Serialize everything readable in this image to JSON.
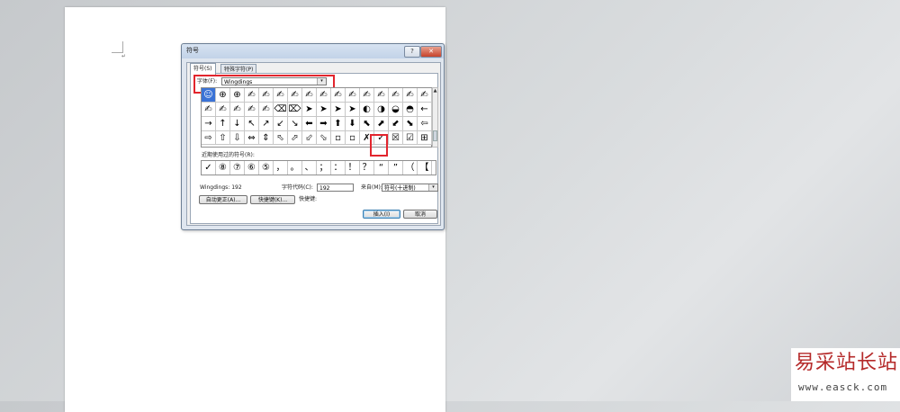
{
  "document": {
    "paragraph_mark": "↵"
  },
  "dialog": {
    "title": "符号",
    "help_label": "?",
    "close_label": "✕",
    "tabs": [
      {
        "label": "符号(S)"
      },
      {
        "label": "特殊字符(P)"
      }
    ],
    "font_label": "字体(F):",
    "font_value": "Wingdings",
    "dropdown_arrow": "▾",
    "scroll_up": "▲",
    "symbols": [
      [
        "☺",
        "⊕",
        "⊕",
        "✍",
        "✍",
        "✍",
        "✍",
        "✍",
        "✍",
        "✍",
        "✍",
        "✍",
        "✍",
        "✍",
        "✍",
        "✍",
        "✍",
        "✍",
        "✍",
        "✍",
        "✍",
        "✍",
        "✍",
        "✍",
        "✍",
        "✍",
        "✍",
        "✍"
      ],
      [
        "✍",
        "✍",
        "✍",
        "✍",
        "✍",
        "⌫",
        "⌦",
        "➤",
        "➤",
        "➤",
        "➤",
        "◐",
        "◑",
        "◒",
        "◓",
        "←",
        "",
        "",
        "",
        "",
        "",
        "",
        "",
        "",
        "",
        "",
        "",
        ""
      ],
      [
        "→",
        "↑",
        "↓",
        "↖",
        "↗",
        "↙",
        "↘",
        "⬅",
        "➡",
        "⬆",
        "⬇",
        "⬉",
        "⬈",
        "⬋",
        "⬊",
        "⇦",
        "",
        "",
        "",
        "",
        "",
        "",
        "",
        "",
        "",
        "",
        "",
        ""
      ],
      [
        "⇨",
        "⇧",
        "⇩",
        "⇔",
        "⇕",
        "⬁",
        "⬀",
        "⬃",
        "⬂",
        "▫",
        "▫",
        "✗",
        "✓",
        "☒",
        "☑",
        "⊞",
        "",
        "",
        "",
        "",
        "",
        "",
        "",
        "",
        "",
        "",
        "",
        ""
      ]
    ],
    "recent_label": "近期使用过的符号(R):",
    "recent_symbols": [
      "✓",
      "⑧",
      "⑦",
      "⑥",
      "⑤",
      "，",
      "。",
      "、",
      "；",
      "：",
      "！",
      "？",
      "“",
      "”",
      "（",
      "【"
    ],
    "charset_info": "Wingdings: 192",
    "code_label": "字符代码(C):",
    "code_value": "192",
    "from_label": "来自(M):",
    "from_value": "符号(十进制)",
    "autocorrect_button": "自动更正(A)...",
    "shortcut_button": "快捷键(K)...",
    "shortcut_text": "快捷键:",
    "insert_button": "插入(I)",
    "cancel_button": "取消"
  },
  "watermark": {
    "brand": "易采站长站",
    "url": "www.easck.com"
  }
}
